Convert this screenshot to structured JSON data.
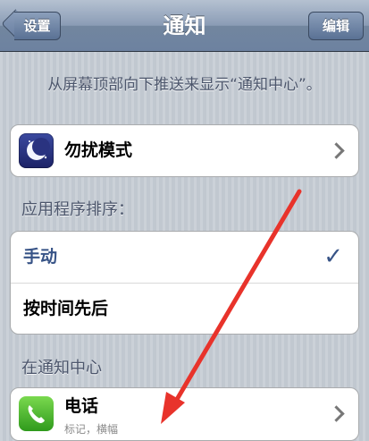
{
  "navbar": {
    "title": "通知",
    "back_label": "设置",
    "edit_label": "编辑"
  },
  "hint": "从屏幕顶部向下推送来显示“通知中心”。",
  "do_not_disturb": {
    "label": "勿扰模式"
  },
  "sort_section": {
    "header": "应用程序排序：",
    "options": [
      {
        "label": "手动",
        "selected": true
      },
      {
        "label": "按时间先后",
        "selected": false
      }
    ]
  },
  "notification_center": {
    "header": "在通知中心",
    "apps": [
      {
        "name": "电话",
        "subtitle": "标记，横幅"
      }
    ]
  },
  "colors": {
    "selected_text": "#385487",
    "annotation_arrow": "#e8332b"
  },
  "icons": {
    "moon": "moon-icon",
    "phone": "phone-icon",
    "check": "checkmark-icon"
  }
}
